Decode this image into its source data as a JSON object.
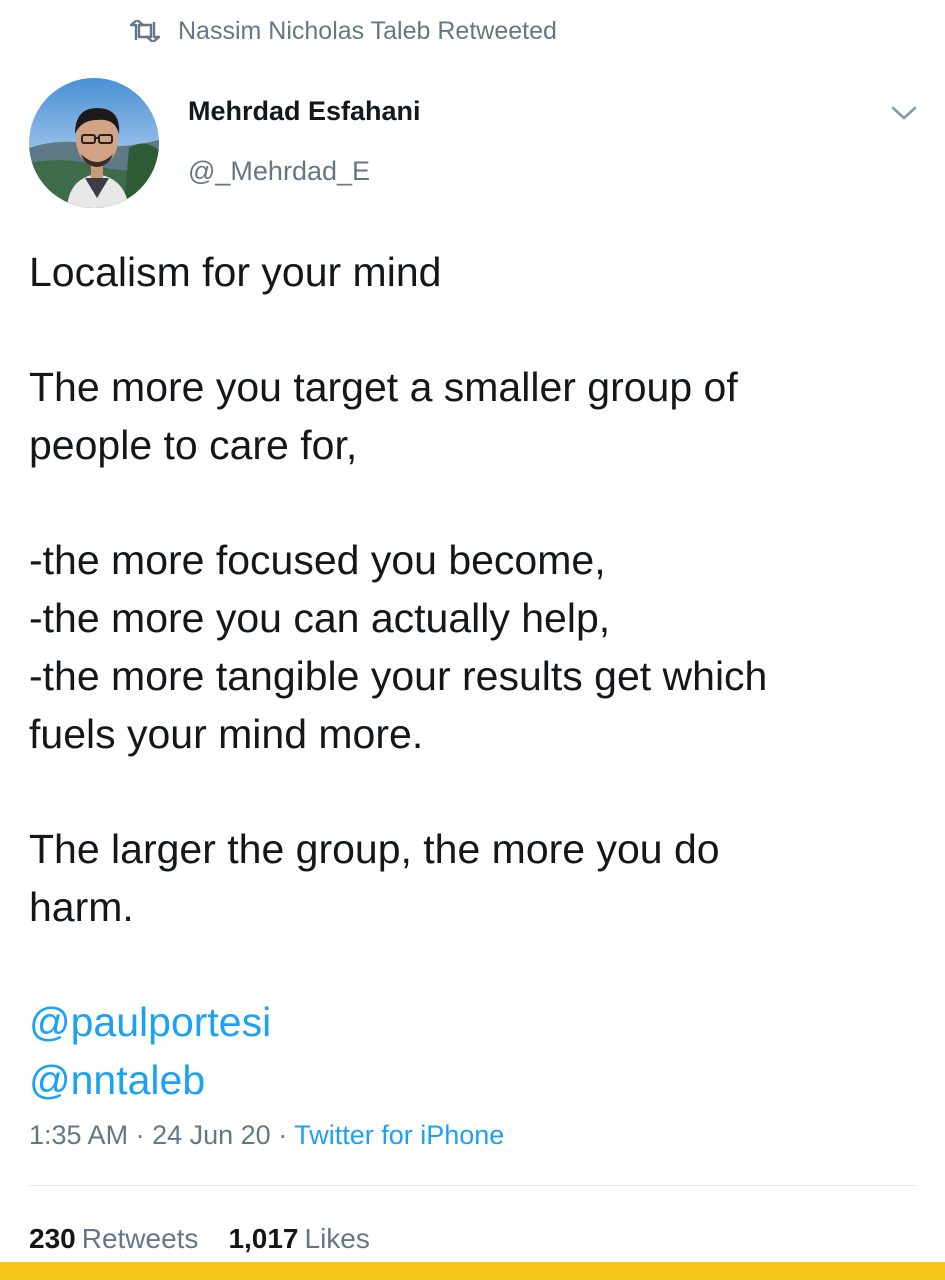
{
  "retweet_context": {
    "icon": "retweet-icon",
    "text": "Nassim Nicholas Taleb Retweeted"
  },
  "author": {
    "display_name": "Mehrdad Esfahani",
    "handle": "@_Mehrdad_E",
    "avatar_icon": "user-avatar"
  },
  "menu_icon": "chevron-down-icon",
  "tweet": {
    "lines": [
      "Localism for your mind",
      "",
      "The more you target a smaller group of",
      "people to care for,",
      "",
      "-the more focused you become,",
      "-the more you can actually help,",
      "-the more tangible your results get which",
      "fuels your mind more.",
      "",
      "The larger the group, the more you do",
      "harm.",
      ""
    ],
    "mentions": [
      "@paulportesi",
      "@nntaleb"
    ]
  },
  "meta": {
    "time": "1:35 AM",
    "separator": "·",
    "date": "24 Jun 20",
    "source": "Twitter for iPhone"
  },
  "stats": {
    "retweets_count": "230",
    "retweets_label": "Retweets",
    "likes_count": "1,017",
    "likes_label": "Likes"
  },
  "colors": {
    "link": "#1da1f2",
    "secondary_text": "#657786",
    "primary_text": "#14171a",
    "bottom_bar": "#f7c518"
  }
}
